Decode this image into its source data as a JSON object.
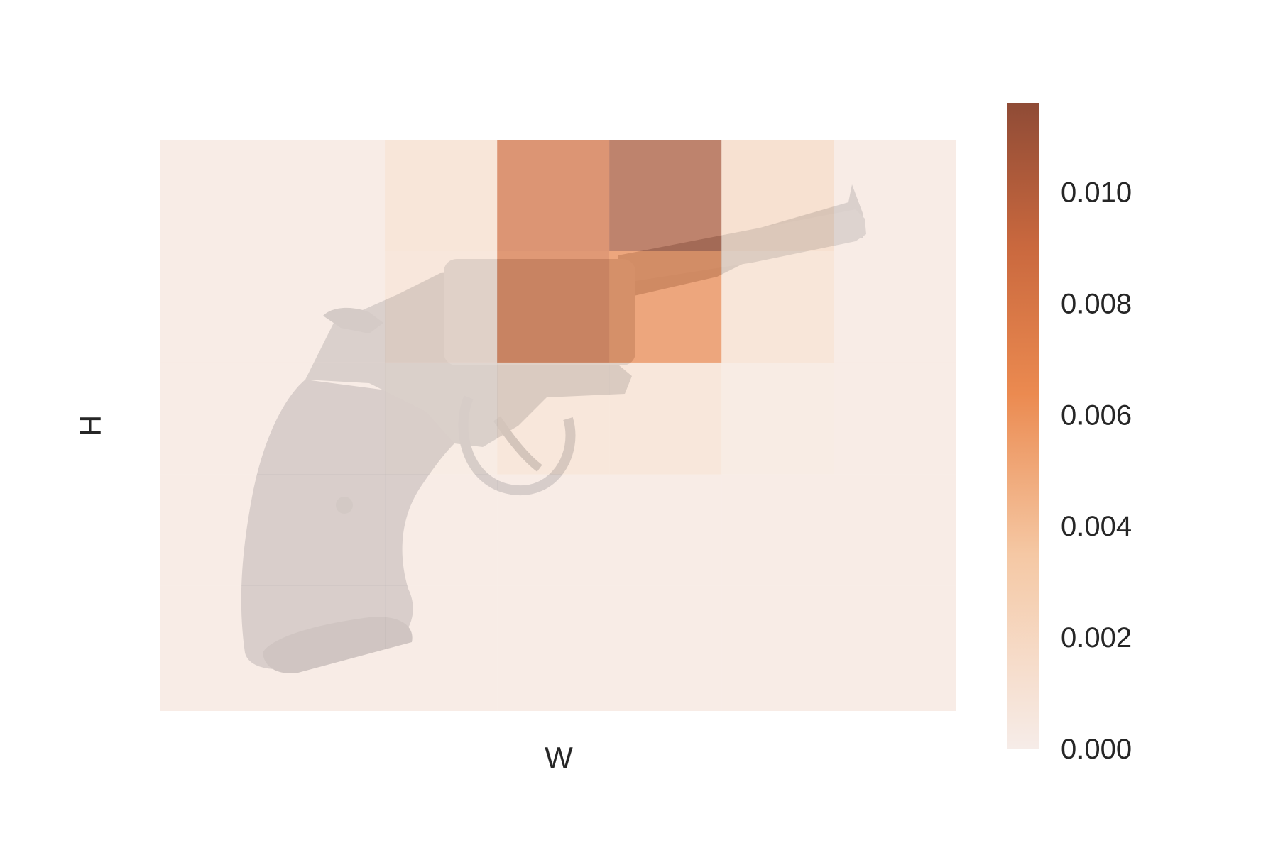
{
  "chart_data": {
    "type": "heatmap",
    "title": "",
    "xlabel": "W",
    "ylabel": "H",
    "background_image": "revolver-photo",
    "grid": [
      [
        0.0004,
        0.0004,
        0.0013,
        0.0085,
        0.0106,
        0.0019,
        0.0004
      ],
      [
        0.0004,
        0.0004,
        0.0011,
        0.008,
        0.0066,
        0.0013,
        0.0004
      ],
      [
        0.0004,
        0.0004,
        0.0005,
        0.0012,
        0.0012,
        0.0005,
        0.0004
      ],
      [
        0.0004,
        0.0004,
        0.0004,
        0.0004,
        0.0004,
        0.0004,
        0.0004
      ],
      [
        0.0004,
        0.0004,
        0.0004,
        0.0004,
        0.0004,
        0.0004,
        0.0004
      ]
    ],
    "colorbar": {
      "ticks": [
        "0.000",
        "0.002",
        "0.004",
        "0.006",
        "0.008",
        "0.010"
      ],
      "tick_values": [
        0.0,
        0.002,
        0.004,
        0.006,
        0.008,
        0.01
      ],
      "min": 0.0,
      "max": 0.0116
    },
    "colors": {
      "low": "#f6ece8",
      "mid1": "#f5c8a4",
      "mid2": "#eb8a50",
      "mid3": "#c9683e",
      "high": "#8f4b36"
    }
  }
}
